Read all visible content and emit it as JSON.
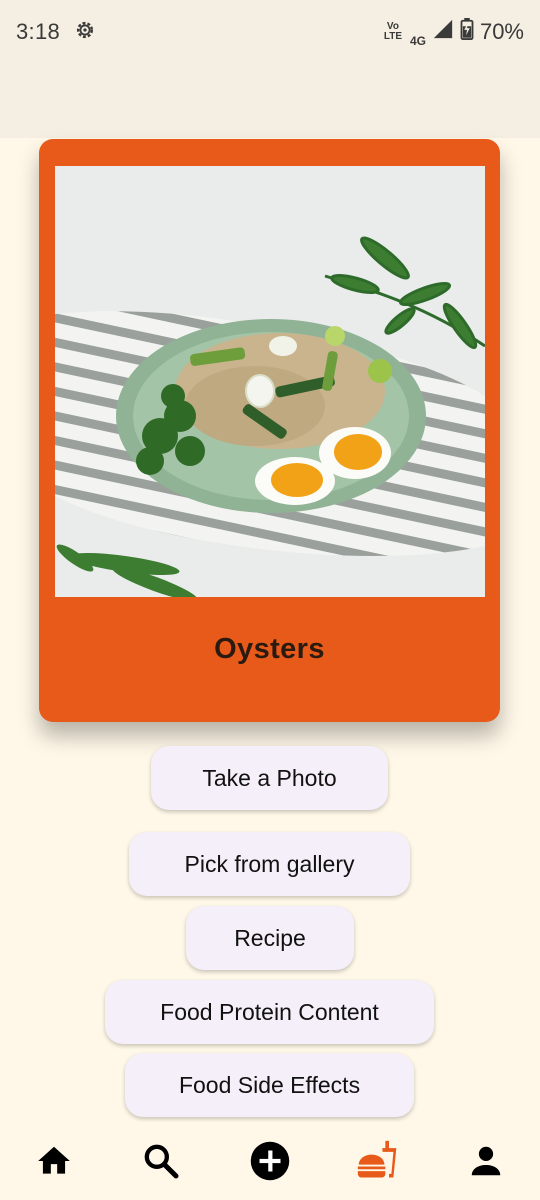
{
  "status_bar": {
    "time": "3:18",
    "volte_top": "Vo",
    "volte_bottom": "LTE",
    "network": "4G",
    "battery": "70%"
  },
  "card": {
    "title": "Oysters",
    "image_icon": "food-photo-rice-bowl"
  },
  "actions": {
    "take_photo": "Take a Photo",
    "pick_gallery": "Pick from gallery",
    "recipe": "Recipe",
    "protein": "Food Protein Content",
    "side_effects": "Food Side Effects"
  },
  "nav": {
    "items": [
      "home-icon",
      "search-icon",
      "add-circle-icon",
      "fastfood-icon",
      "profile-icon"
    ],
    "active_index": 3,
    "active_color": "#E85A19",
    "inactive_color": "#000000"
  },
  "colors": {
    "accent": "#E85A19",
    "background": "#FFF8E8",
    "button_bg": "#F4EFF8"
  }
}
